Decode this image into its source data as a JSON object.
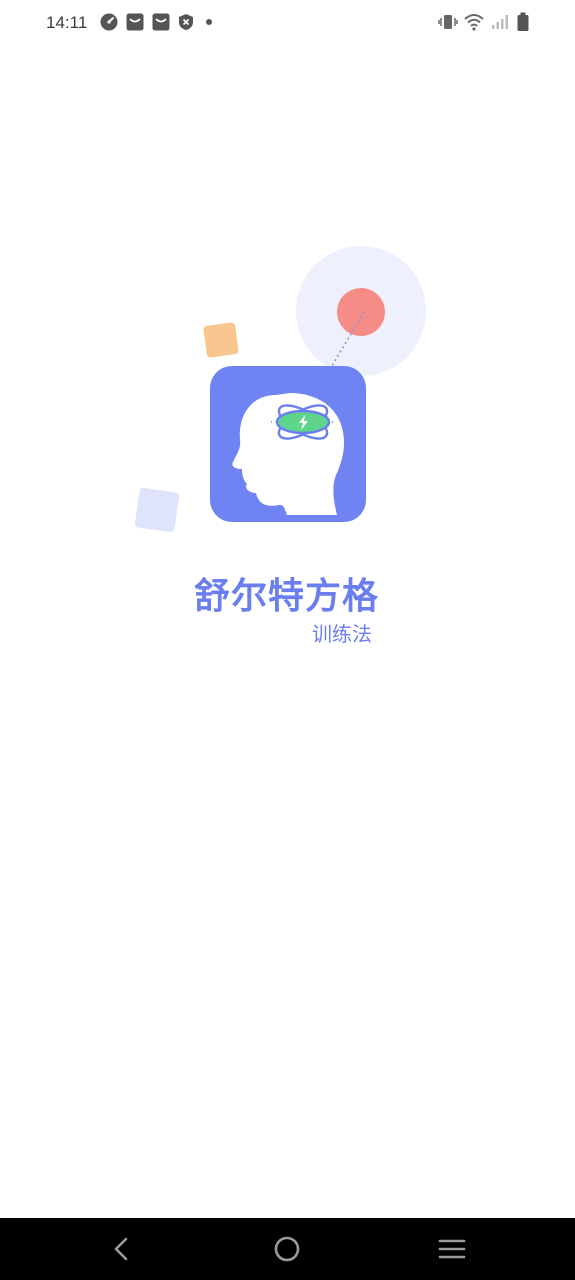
{
  "status_bar": {
    "time": "14:11",
    "left_icons": [
      "speed-icon",
      "mail-icon",
      "mail-icon",
      "shield-icon",
      "dot-icon"
    ],
    "right_icons": [
      "vibrate-icon",
      "wifi-icon",
      "signal-icon",
      "battery-icon"
    ]
  },
  "splash": {
    "title": "舒尔特方格",
    "subtitle": "训练法",
    "colors": {
      "brand": "#6b7ef0",
      "tile": "#7083f3",
      "orange_square": "#f7c78f",
      "lavender_square": "#dfe3fb",
      "circle_outer": "#eef0fd",
      "circle_inner": "#f58d86",
      "bolt": "#5fd58b"
    }
  },
  "nav_bar": {
    "buttons": [
      "back",
      "home",
      "recents"
    ]
  }
}
